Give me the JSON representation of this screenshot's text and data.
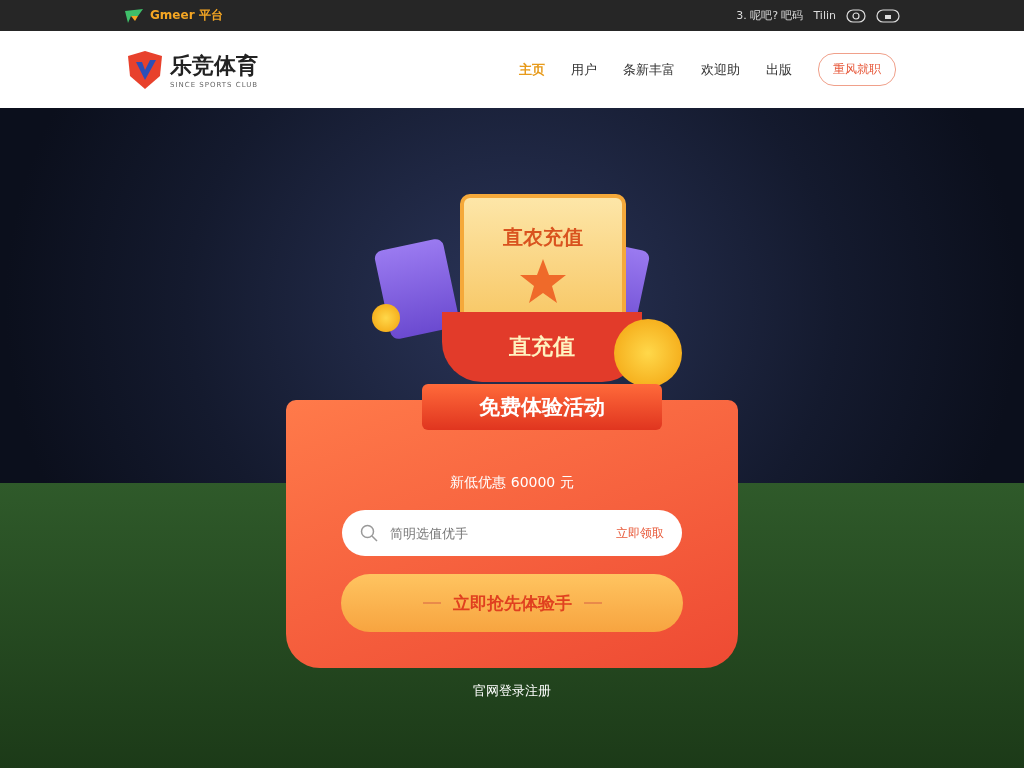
{
  "top_bar": {
    "brand": "Gmeer 平台",
    "links": [
      "3. 呢吧? 吧码",
      "Tilin"
    ]
  },
  "header": {
    "logo": "乐竞体育",
    "logo_subtitle": "SINCE SPORTS CLUB",
    "nav": [
      {
        "label": "主页",
        "selected": true
      },
      {
        "label": "用户",
        "selected": false
      },
      {
        "label": "条新丰富",
        "selected": false
      },
      {
        "label": "欢迎助",
        "selected": false
      },
      {
        "label": "出版",
        "selected": false
      }
    ],
    "cta": "重风就职"
  },
  "promo": {
    "ticket_title": "直农充值",
    "band_title": "直充值",
    "banner": "免费体验活动",
    "subtitle": "新低优惠 60000 元",
    "search": {
      "placeholder": "简明选值优手",
      "action": "立即领取"
    },
    "button": "立即抢先体验手",
    "footer_link": "官网登录注册"
  }
}
